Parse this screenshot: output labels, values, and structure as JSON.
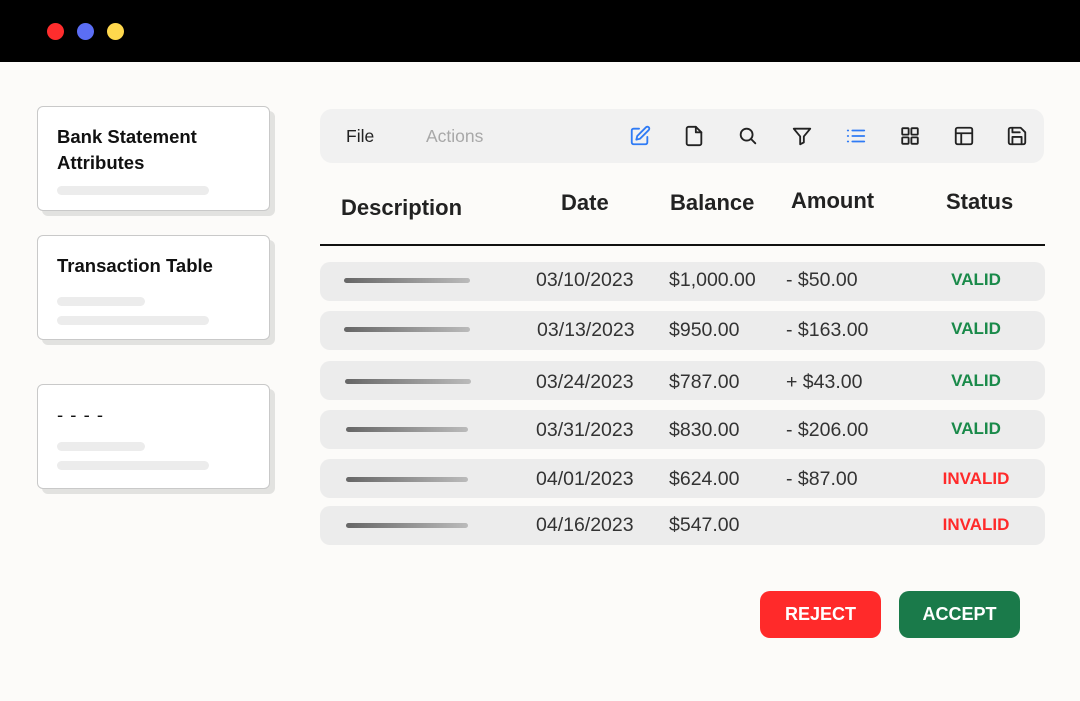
{
  "window": {
    "controls": [
      "close",
      "minimize",
      "maximize"
    ]
  },
  "sidebar": {
    "cards": [
      {
        "title": "Bank Statement Attributes"
      },
      {
        "title": "Transaction Table"
      },
      {
        "title": "- - - -"
      }
    ]
  },
  "toolbar": {
    "menus": [
      "File",
      "Actions"
    ],
    "icons": [
      "edit-icon",
      "file-icon",
      "search-icon",
      "filter-icon",
      "list-view-icon",
      "grid-view-icon",
      "layout-icon",
      "save-icon"
    ],
    "active_color": "#2f7bf5"
  },
  "table": {
    "headers": [
      "Description",
      "Date",
      "Balance",
      "Amount",
      "Status"
    ],
    "rows": [
      {
        "date": "03/10/2023",
        "balance": "$1,000.00",
        "amount": "- $50.00",
        "status": "VALID"
      },
      {
        "date": "03/13/2023",
        "balance": "$950.00",
        "amount": "- $163.00",
        "status": "VALID"
      },
      {
        "date": "03/24/2023",
        "balance": "$787.00",
        "amount": "+ $43.00",
        "status": "VALID"
      },
      {
        "date": "03/31/2023",
        "balance": "$830.00",
        "amount": "- $206.00",
        "status": "VALID"
      },
      {
        "date": "04/01/2023",
        "balance": "$624.00",
        "amount": "- $87.00",
        "status": "INVALID"
      },
      {
        "date": "04/16/2023",
        "balance": "$547.00",
        "amount": "",
        "status": "INVALID"
      }
    ],
    "status_colors": {
      "VALID": "#1a8a4a",
      "INVALID": "#ff2a2a"
    }
  },
  "actions": {
    "reject_label": "REJECT",
    "accept_label": "ACCEPT"
  }
}
